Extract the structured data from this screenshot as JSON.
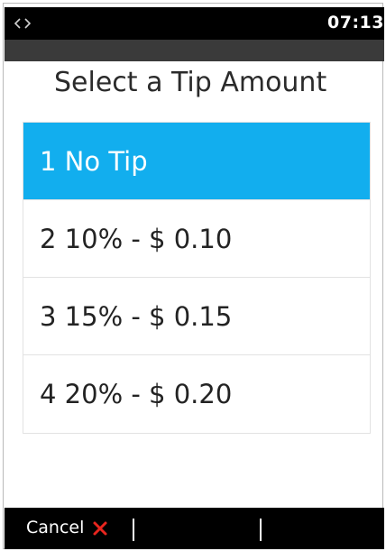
{
  "status_bar": {
    "connection_icon": "link-arrows-icon",
    "time": "07:13"
  },
  "screen": {
    "title": "Select a Tip Amount",
    "options": [
      {
        "label": "1 No Tip",
        "selected": true
      },
      {
        "label": "2 10% - $ 0.10",
        "selected": false
      },
      {
        "label": "3 15% - $ 0.15",
        "selected": false
      },
      {
        "label": "4 20% - $ 0.20",
        "selected": false
      }
    ]
  },
  "soft_keys": {
    "cancel_label": "Cancel",
    "cancel_icon": "close-x-icon"
  },
  "colors": {
    "selected_bg": "#12aeee",
    "bar_bg": "#000000",
    "cancel_x": "#e8251e"
  }
}
